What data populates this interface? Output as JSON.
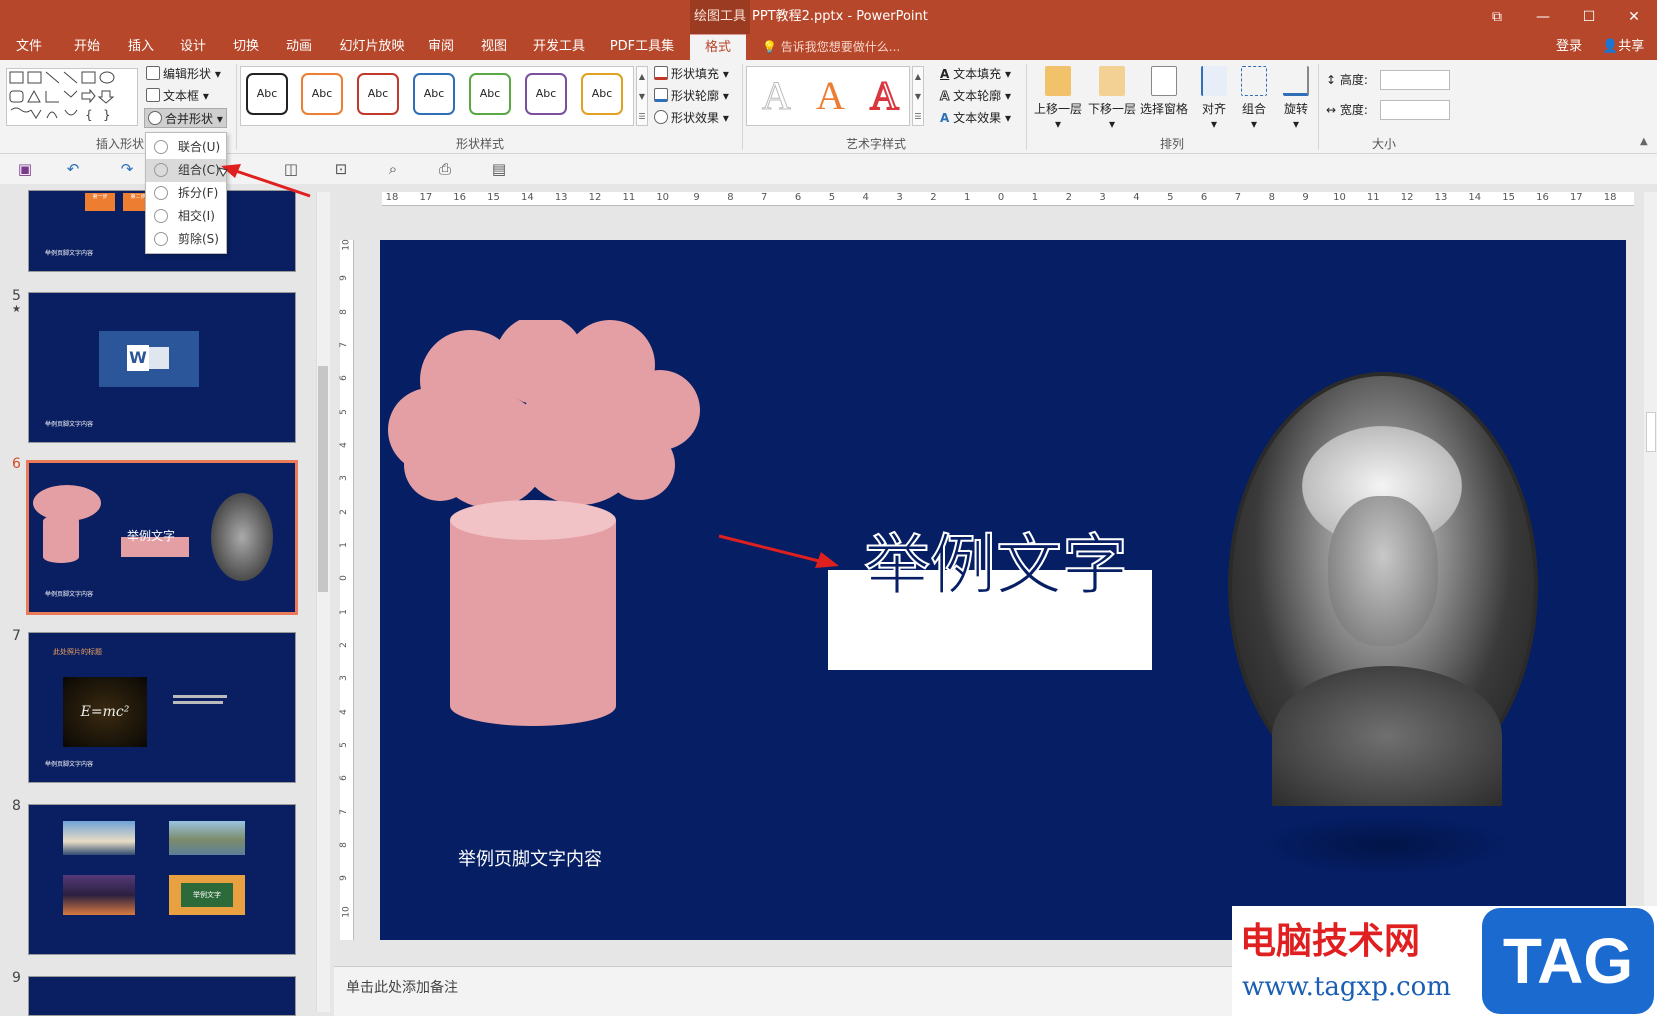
{
  "window": {
    "context_tab": "绘图工具",
    "title": "PPT教程2.pptx - PowerPoint",
    "controls": [
      "⧉",
      "—",
      "☐",
      "✕"
    ]
  },
  "tabs": [
    "文件",
    "开始",
    "插入",
    "设计",
    "切换",
    "动画",
    "幻灯片放映",
    "审阅",
    "视图",
    "开发工具",
    "PDF工具集",
    "格式"
  ],
  "active_tab": "格式",
  "tell_me": "告诉我您想要做什么...",
  "account": {
    "login": "登录",
    "share": "共享"
  },
  "ribbon": {
    "insert_shapes": {
      "edit_shape": "编辑形状",
      "text_box": "文本框",
      "merge_shapes": "合并形状",
      "label": "插入形状"
    },
    "shape_styles": {
      "samples": [
        "Abc",
        "Abc",
        "Abc",
        "Abc",
        "Abc",
        "Abc",
        "Abc"
      ],
      "sample_colors": [
        "#222222",
        "#ed7d31",
        "#c0392b",
        "#2e6fb7",
        "#5aa845",
        "#7b4f9d",
        "#e0a020"
      ],
      "fill": "形状填充",
      "outline": "形状轮廓",
      "effects": "形状效果",
      "label": "形状样式"
    },
    "wordart": {
      "letters": [
        "A",
        "A",
        "A"
      ],
      "letter_colors": [
        "#dddddd",
        "#ed7d31",
        "#d9363e"
      ],
      "text_fill": "文本填充",
      "text_outline": "文本轮廓",
      "text_effects": "文本效果",
      "label": "艺术字样式"
    },
    "arrange": {
      "bring_forward": "上移一层",
      "send_backward": "下移一层",
      "selection_pane": "选择窗格",
      "align": "对齐",
      "group": "组合",
      "rotate": "旋转",
      "label": "排列"
    },
    "size": {
      "height_label": "高度:",
      "width_label": "宽度:",
      "label": "大小"
    }
  },
  "merge_menu": [
    {
      "label": "联合(U)",
      "hot": false
    },
    {
      "label": "组合(C)",
      "hot": true
    },
    {
      "label": "拆分(F)",
      "hot": false
    },
    {
      "label": "相交(I)",
      "hot": false
    },
    {
      "label": "剪除(S)",
      "hot": false
    }
  ],
  "ruler": {
    "h_ticks": [
      "18",
      "17",
      "16",
      "15",
      "14",
      "13",
      "12",
      "11",
      "10",
      "9",
      "8",
      "7",
      "6",
      "5",
      "4",
      "3",
      "2",
      "1",
      "0",
      "1",
      "2",
      "3",
      "4",
      "5",
      "6",
      "7",
      "8",
      "9",
      "10",
      "11",
      "12",
      "13",
      "14",
      "15",
      "16",
      "17",
      "18"
    ],
    "v_ticks": [
      "10",
      "9",
      "8",
      "7",
      "6",
      "5",
      "4",
      "3",
      "2",
      "1",
      "0",
      "1",
      "2",
      "3",
      "4",
      "5",
      "6",
      "7",
      "8",
      "9",
      "10"
    ]
  },
  "thumbnails": {
    "slide4": {
      "step1": "第一步",
      "step2": "第二步",
      "footer": "举例页脚文字内容"
    },
    "slide5": {
      "num": "5",
      "star": "★",
      "word_logo": "W",
      "footer": "举例页脚文字内容"
    },
    "slide6": {
      "num": "6",
      "text": "举例文字",
      "footer": "举例页脚文字内容"
    },
    "slide7": {
      "num": "7",
      "title": "此处照片的标题",
      "formula": "E=mc²",
      "footer": "举例页脚文字内容"
    },
    "slide8": {
      "num": "8",
      "label": "举例文字"
    },
    "slide9": {
      "num": "9"
    }
  },
  "slide": {
    "text": "举例文字",
    "footer": "举例页脚文字内容"
  },
  "notes": "单击此处添加备注",
  "watermark": {
    "cn": "电脑技术网",
    "url": "www.tagxp.com",
    "tag": "TAG"
  }
}
